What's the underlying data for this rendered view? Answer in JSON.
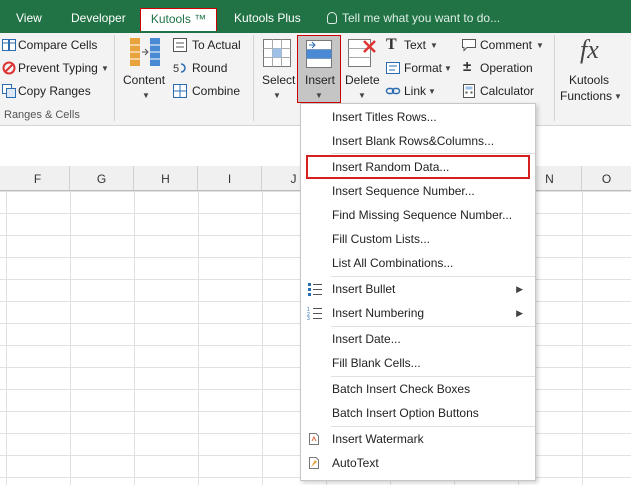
{
  "tabs": {
    "view": "View",
    "developer": "Developer",
    "kutools": "Kutools ™",
    "kutools_plus": "Kutools Plus",
    "tell_me": "Tell me what you want to do..."
  },
  "ribbon": {
    "compare_cells": "Compare Cells",
    "prevent_typing": "Prevent Typing",
    "copy_ranges": "Copy Ranges",
    "content": "Content",
    "to_actual": "To Actual",
    "round": "Round",
    "combine": "Combine",
    "select": "Select",
    "insert": "Insert",
    "delete": "Delete",
    "text": "Text",
    "format": "Format",
    "link": "Link",
    "comment": "Comment",
    "operation": "Operation",
    "calculator": "Calculator",
    "kutools_functions_1": "Kutools",
    "kutools_functions_2": "Functions",
    "fx": "fx",
    "group_label": "Ranges & Cells"
  },
  "columns": [
    "F",
    "G",
    "H",
    "I",
    "J",
    "N",
    "O"
  ],
  "menu": {
    "items": [
      "Insert Titles Rows...",
      "Insert Blank Rows&Columns...",
      "Insert Random Data...",
      "Insert Sequence Number...",
      "Find Missing Sequence Number...",
      "Fill Custom Lists...",
      "List All Combinations...",
      "Insert Bullet",
      "Insert Numbering",
      "Insert Date...",
      "Fill Blank Cells...",
      "Batch Insert Check Boxes",
      "Batch Insert Option Buttons",
      "Insert Watermark",
      "AutoText"
    ]
  },
  "colors": {
    "tab_bar": "#217346",
    "highlight_border": "#d42020"
  }
}
